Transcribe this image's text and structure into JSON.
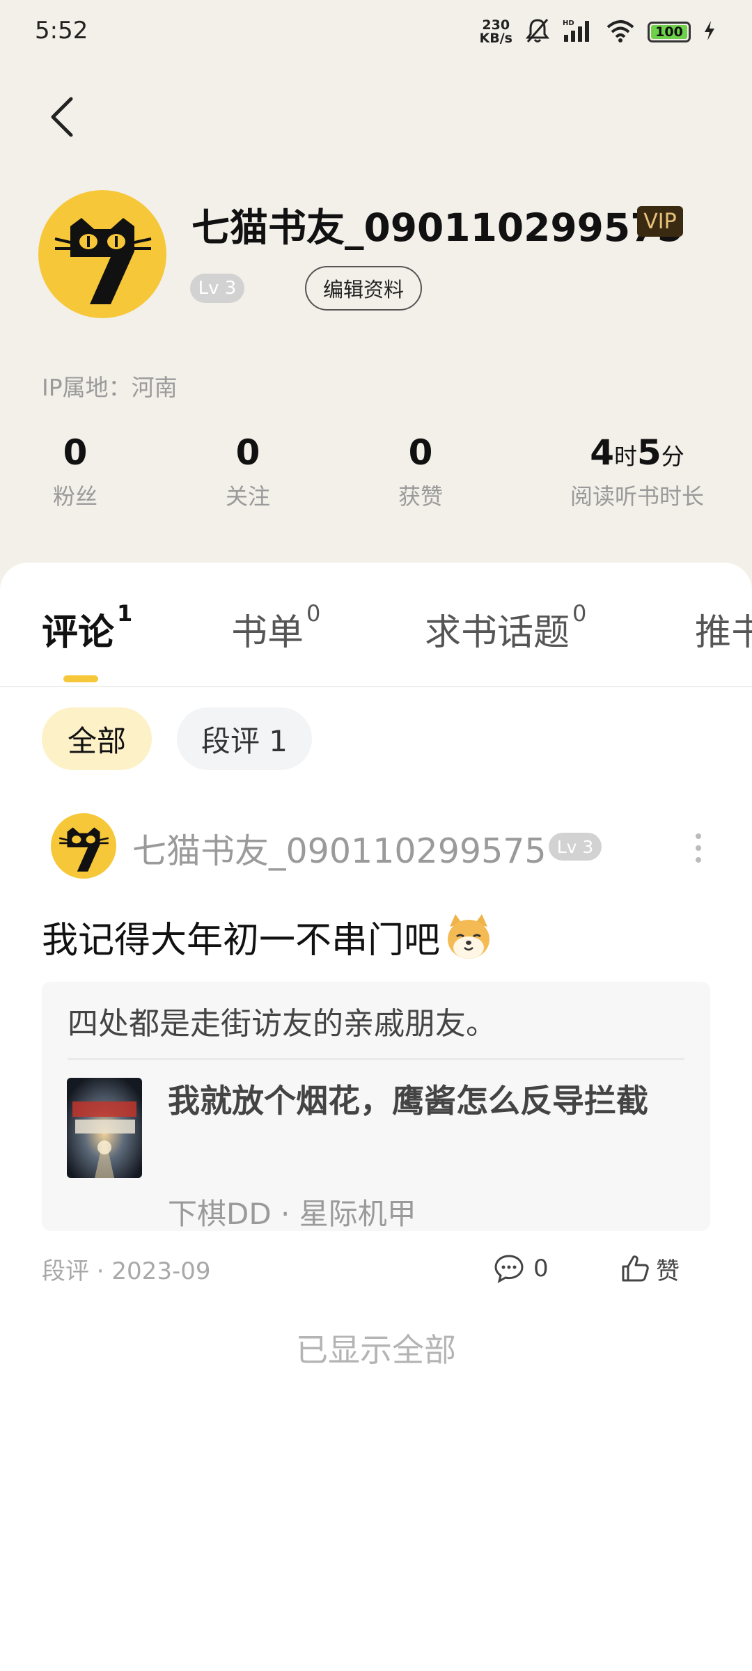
{
  "status_bar": {
    "time": "5:52",
    "net_speed_value": "230",
    "net_speed_unit": "KB/s",
    "battery": "100"
  },
  "profile": {
    "username": "七猫书友_090110299575",
    "vip": "VIP",
    "level": "Lv 3",
    "edit_label": "编辑资料",
    "ip_location": "IP属地：河南",
    "stats": {
      "fans_value": "0",
      "fans_label": "粉丝",
      "follow_value": "0",
      "follow_label": "关注",
      "likes_value": "0",
      "likes_label": "获赞",
      "read_hours": "4",
      "read_hours_unit": "时",
      "read_minutes": "5",
      "read_minutes_unit": "分",
      "read_label": "阅读听书时长"
    }
  },
  "tabs": [
    {
      "label": "评论",
      "count": "1"
    },
    {
      "label": "书单",
      "count": "0"
    },
    {
      "label": "求书话题",
      "count": "0"
    },
    {
      "label": "推书"
    }
  ],
  "filters": {
    "all": "全部",
    "segment": "段评 1"
  },
  "comment": {
    "username": "七猫书友_090110299575",
    "level": "Lv 3",
    "text": "我记得大年初一不串门吧",
    "quote": "四处都是走街访友的亲戚朋友。",
    "book_title": "我就放个烟花，鹰酱怎么反导拦截",
    "book_meta": "下棋DD · 星际机甲",
    "meta": "段评 · 2023-09",
    "reply_count": "0",
    "like_label": "赞"
  },
  "footer_text": "已显示全部",
  "colors": {
    "header_bg": "#f3efe9",
    "accent_yellow": "#f6c738",
    "vip_bg": "#3a2a12",
    "vip_text": "#e7c27a"
  }
}
